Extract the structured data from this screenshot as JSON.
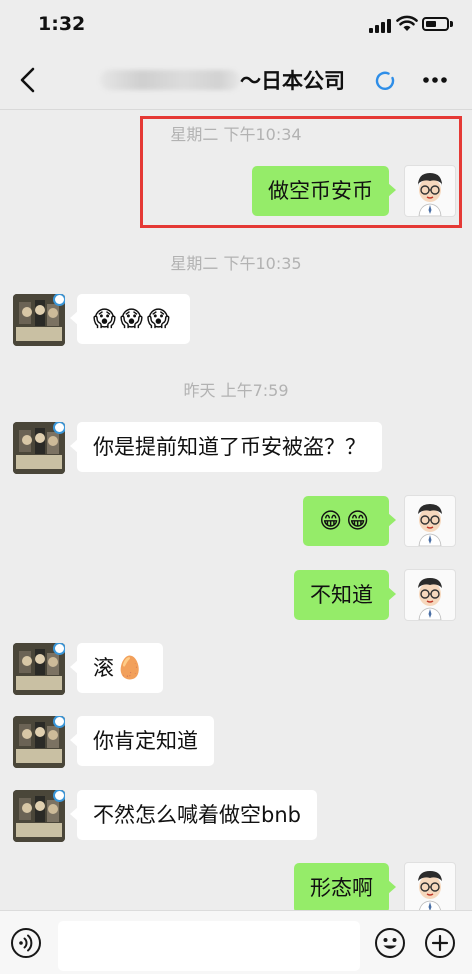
{
  "status_bar": {
    "time": "1:32"
  },
  "nav": {
    "title": "～日本公司"
  },
  "chat": {
    "timestamps": [
      "星期二 下午10:34",
      "星期二 下午10:35",
      "昨天 上午7:59"
    ],
    "messages": [
      {
        "from": "me",
        "text": "做空币安币"
      },
      {
        "from": "friend",
        "emojis": [
          "😱",
          "😱",
          "😱"
        ]
      },
      {
        "from": "friend",
        "text": "你是提前知道了币安被盗？？"
      },
      {
        "from": "me",
        "emojis": [
          "😁",
          "😁"
        ]
      },
      {
        "from": "me",
        "text": "不知道"
      },
      {
        "from": "friend",
        "text": "滚",
        "emojis": [
          "🥚"
        ]
      },
      {
        "from": "friend",
        "text": "你肯定知道"
      },
      {
        "from": "friend",
        "text": "不然怎么喊着做空bnb"
      },
      {
        "from": "me",
        "text": "形态啊"
      }
    ]
  },
  "input_bar": {
    "placeholder": ""
  },
  "colors": {
    "outgoing_bubble": "#95ec69",
    "incoming_bubble": "#ffffff",
    "highlight": "#e53935",
    "background": "#ededed"
  },
  "icons": [
    "back-chevron",
    "refresh-icon",
    "more-icon",
    "voice-icon",
    "emoji-icon",
    "plus-icon"
  ]
}
